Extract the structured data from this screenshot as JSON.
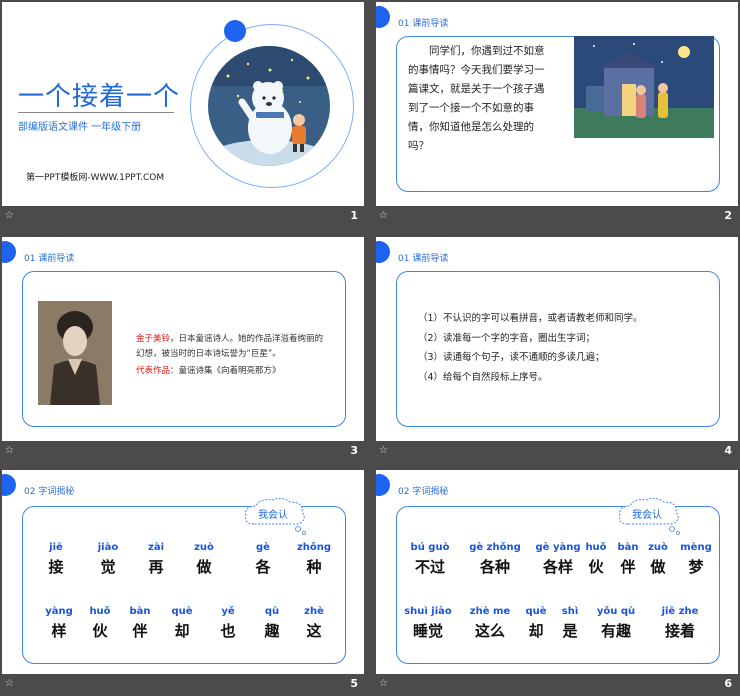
{
  "slides": [
    {
      "number": "1",
      "title": "一个接着一个",
      "subtitle": "部编版语文课件 一年级下册",
      "site": "第一PPT模板网-WWW.1PPT.COM"
    },
    {
      "number": "2",
      "header": "01 课前导读",
      "text": "同学们，你遇到过不如意的事情吗？今天我们要学习一篇课文，就是关于一个孩子遇到了一个接一个不如意的事情，你知道他是怎么处理的吗？"
    },
    {
      "number": "3",
      "header": "01 课前导读",
      "author_name": "金子美铃",
      "author_desc": "，日本童谣诗人。她的作品洋溢着绚丽的幻想，被当时的日本诗坛誉为“巨星”。",
      "works_label": "代表作品",
      "works": "：童谣诗集《向着明亮那方》"
    },
    {
      "number": "4",
      "header": "01 课前导读",
      "items": [
        "（1）不认识的字可以看拼音，或者请教老师和同学。",
        "（2）读准每一个字的字音，圈出生字词；",
        "（3）读通每个句子，读不通顺的多读几遍；",
        "（4）给每个自然段标上序号。"
      ]
    },
    {
      "number": "5",
      "header": "02 字词揭秘",
      "cloud": "我会认",
      "row1": [
        {
          "py": "jiē",
          "hz": "接"
        },
        {
          "py": "jiào",
          "hz": "觉"
        },
        {
          "py": "zài",
          "hz": "再"
        },
        {
          "py": "zuò",
          "hz": "做"
        },
        {
          "py": "gè",
          "hz": "各"
        },
        {
          "py": "zhǒng",
          "hz": "种"
        }
      ],
      "row2": [
        {
          "py": "yàng",
          "hz": "样"
        },
        {
          "py": "huǒ",
          "hz": "伙"
        },
        {
          "py": "bàn",
          "hz": "伴"
        },
        {
          "py": "què",
          "hz": "却"
        },
        {
          "py": "yě",
          "hz": "也"
        },
        {
          "py": "qù",
          "hz": "趣"
        },
        {
          "py": "zhè",
          "hz": "这"
        }
      ]
    },
    {
      "number": "6",
      "header": "02 字词揭秘",
      "cloud": "我会认",
      "row1": [
        {
          "py": "bú guò",
          "hz": "不过"
        },
        {
          "py": "gè zhǒng",
          "hz": "各种"
        },
        {
          "py": "gè yàng",
          "hz": "各样"
        },
        {
          "py": "huǒ",
          "hz": "伙"
        },
        {
          "py": "bàn",
          "hz": "伴"
        },
        {
          "py": "zuò",
          "hz": "做"
        },
        {
          "py": "mèng",
          "hz": "梦"
        }
      ],
      "row2": [
        {
          "py": "shuì jiào",
          "hz": "睡觉"
        },
        {
          "py": "zhè me",
          "hz": "这么"
        },
        {
          "py": "què",
          "hz": "却"
        },
        {
          "py": "shì",
          "hz": "是"
        },
        {
          "py": "yǒu qù",
          "hz": "有趣"
        },
        {
          "py": "jiē zhe",
          "hz": "接着"
        }
      ]
    }
  ]
}
